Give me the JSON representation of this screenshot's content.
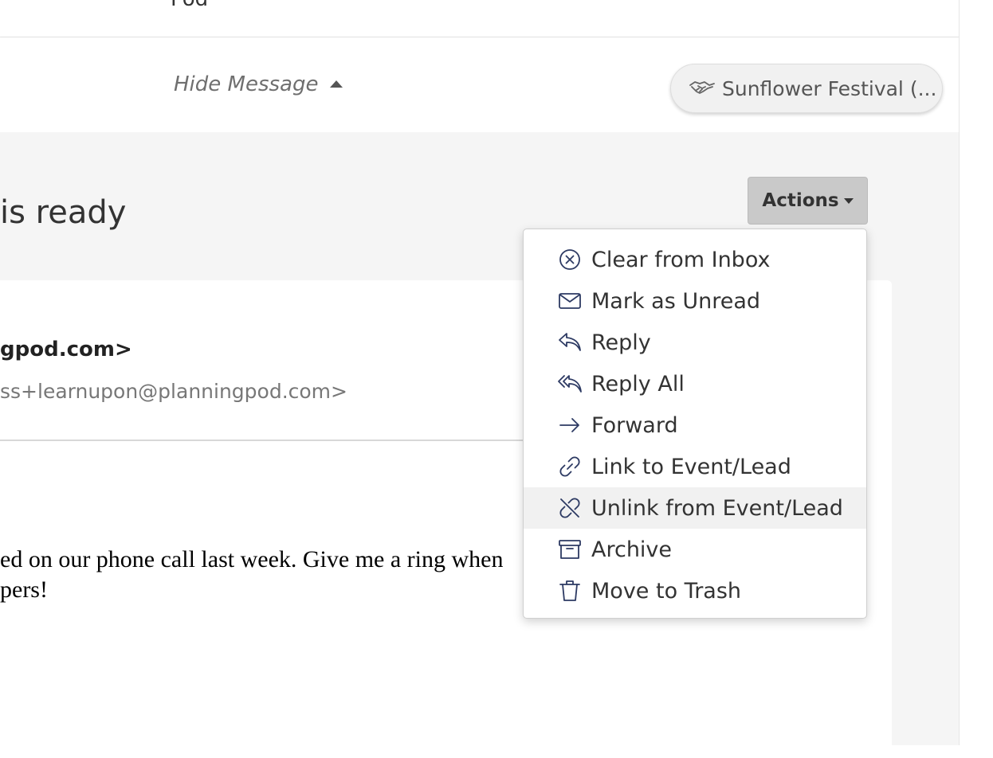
{
  "top_strip": {
    "partial_text": "Pod"
  },
  "hide_bar": {
    "hide_message_label": "Hide Message",
    "event_pill_label": "Sunflower Festival (..."
  },
  "message": {
    "subject_partial": "is ready",
    "from_partial": "gpod.com>",
    "to_partial": "ss+learnupon@planningpod.com>",
    "body_lines": "ed on our phone call last week. Give me a ring when\npers!"
  },
  "actions": {
    "button_label": "Actions",
    "menu_items": [
      {
        "label": "Clear from Inbox",
        "icon": "circle-x-icon"
      },
      {
        "label": "Mark as Unread",
        "icon": "envelope-icon"
      },
      {
        "label": "Reply",
        "icon": "reply-icon"
      },
      {
        "label": "Reply All",
        "icon": "reply-all-icon"
      },
      {
        "label": "Forward",
        "icon": "forward-arrow-icon"
      },
      {
        "label": "Link to Event/Lead",
        "icon": "link-icon"
      },
      {
        "label": "Unlink from Event/Lead",
        "icon": "unlink-icon"
      },
      {
        "label": "Archive",
        "icon": "archive-box-icon"
      },
      {
        "label": "Move to Trash",
        "icon": "trash-icon"
      }
    ],
    "hovered_item": "Unlink from Event/Lead"
  },
  "colors": {
    "icon_navy": "#2d3a63",
    "actions_button_bg": "#c9c9c9",
    "page_bg": "#f5f5f5"
  }
}
